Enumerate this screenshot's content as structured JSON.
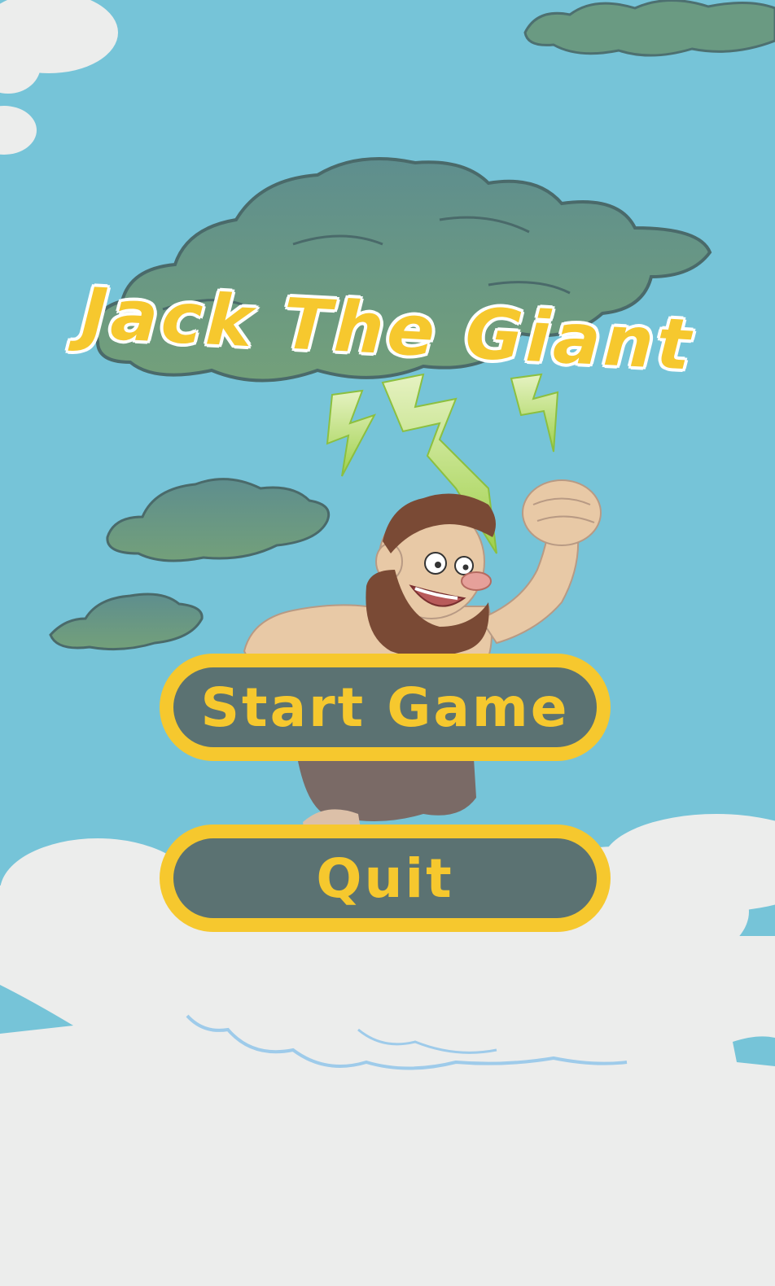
{
  "game": {
    "title": "Jack The Giant"
  },
  "menu": {
    "start_label": "Start Game",
    "quit_label": "Quit"
  },
  "colors": {
    "sky": "#76c4d8",
    "ground_cloud": "#ecedec",
    "accent_yellow": "#f6c82e",
    "button_fill": "#5b7272",
    "storm_cloud": "#6a9a8c",
    "lightning": "#b9e06a",
    "giant_skin": "#e8c9a6",
    "giant_beard": "#7a4a35"
  },
  "icons": {
    "storm_cloud": "storm-cloud-icon",
    "lightning": "lightning-bolt-icon",
    "giant": "caveman-giant-character"
  }
}
